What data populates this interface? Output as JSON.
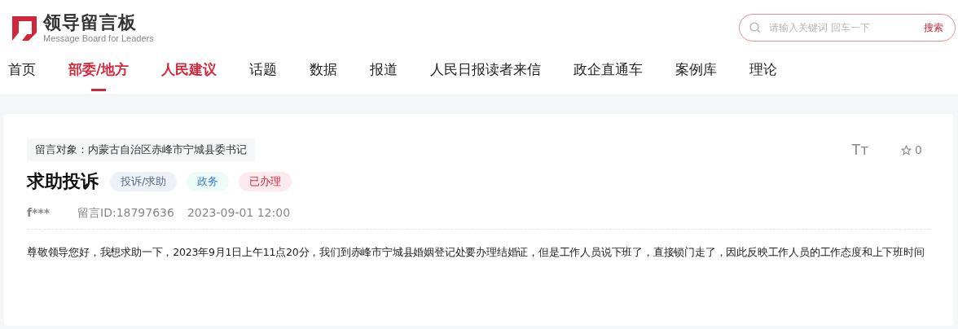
{
  "logo": {
    "title": "领导留言板",
    "subtitle": "Message Board for Leaders"
  },
  "search": {
    "placeholder": "请输入关键词 回车一下",
    "button": "搜索"
  },
  "nav": [
    {
      "label": "首页",
      "selected": false,
      "kind": "plain"
    },
    {
      "label": "部委/地方",
      "selected": true,
      "kind": "plain"
    },
    {
      "label": "人民建议",
      "selected": false,
      "kind": "brand"
    },
    {
      "label": "话题",
      "selected": false,
      "kind": "plain"
    },
    {
      "label": "数据",
      "selected": false,
      "kind": "plain"
    },
    {
      "label": "报道",
      "selected": false,
      "kind": "plain"
    },
    {
      "label": "人民日报读者来信",
      "selected": false,
      "kind": "plain"
    },
    {
      "label": "政企直通车",
      "selected": false,
      "kind": "plain"
    },
    {
      "label": "案例库",
      "selected": false,
      "kind": "plain"
    },
    {
      "label": "理论",
      "selected": false,
      "kind": "plain"
    }
  ],
  "message": {
    "target": "留言对象：内蒙古自治区赤峰市宁城县委书记",
    "font_size_button": "Tт",
    "favorites": "0",
    "title": "求助投诉",
    "tags": [
      {
        "label": "投诉/求助",
        "color": "#eef2f8"
      },
      {
        "label": "政务",
        "color": "#edfcf8"
      },
      {
        "label": "已办理",
        "color": "#fdeaee"
      }
    ],
    "author": "f***",
    "id": "留言ID:18797636",
    "time": "2023-09-01 12:00",
    "body": "尊敬领导您好，我想求助一下，2023年9月1日上午11点20分，我们到赤峰市宁城县婚姻登记处要办理结婚证，但是工作人员说下班了，直接锁门走了，因此反映工作人员的工作态度和上下班时间"
  }
}
